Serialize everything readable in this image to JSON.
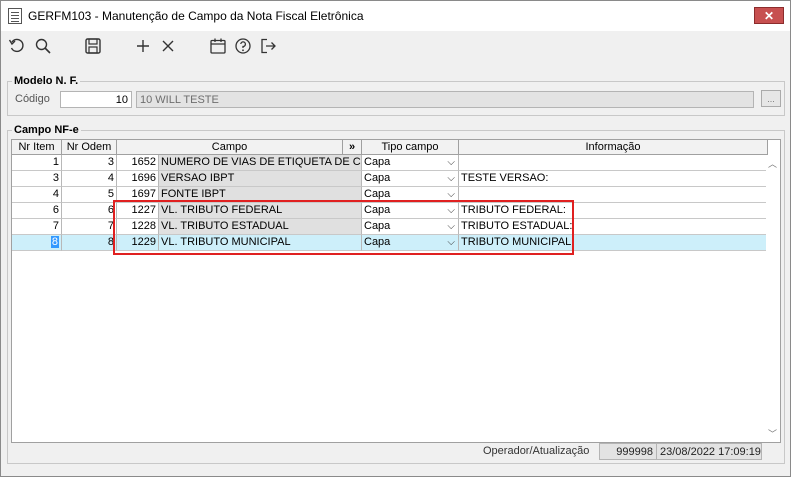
{
  "window": {
    "title": "GERFM103 - Manutenção de Campo da Nota Fiscal Eletrônica",
    "close": "✕"
  },
  "toolbar": {
    "icons": [
      "undo-icon",
      "search-icon",
      "save-icon",
      "add-icon",
      "delete-icon",
      "calendar-icon",
      "help-icon",
      "exit-icon"
    ]
  },
  "modelo": {
    "group_label": "Modelo N. F.",
    "codigo_label": "Código",
    "codigo_value": "10",
    "descricao_value": "10 WILL TESTE",
    "lookup_btn": "..."
  },
  "campo": {
    "group_label": "Campo NF-e",
    "columns": [
      "Nr Item",
      "Nr Odem",
      "Campo",
      "»",
      "Tipo campo",
      "Informação"
    ],
    "rows": [
      {
        "item": "1",
        "ordem": "3",
        "cod": "1652",
        "campo": "NUMERO DE VIAS DE ETIQUETA DE CONT",
        "tipo": "Capa",
        "info": ""
      },
      {
        "item": "3",
        "ordem": "4",
        "cod": "1696",
        "campo": "VERSAO IBPT",
        "tipo": "Capa",
        "info": "TESTE VERSAO:"
      },
      {
        "item": "4",
        "ordem": "5",
        "cod": "1697",
        "campo": "FONTE IBPT",
        "tipo": "Capa",
        "info": ""
      },
      {
        "item": "6",
        "ordem": "6",
        "cod": "1227",
        "campo": "VL. TRIBUTO FEDERAL",
        "tipo": "Capa",
        "info": "TRIBUTO FEDERAL:"
      },
      {
        "item": "7",
        "ordem": "7",
        "cod": "1228",
        "campo": "VL. TRIBUTO ESTADUAL",
        "tipo": "Capa",
        "info": "TRIBUTO ESTADUAL:"
      },
      {
        "item": "8",
        "ordem": "8",
        "cod": "1229",
        "campo": "VL. TRIBUTO MUNICIPAL",
        "tipo": "Capa",
        "info": "TRIBUTO MUNICIPAL:"
      }
    ],
    "chevron": "⌵"
  },
  "status": {
    "label": "Operador/Atualização",
    "operador": "999998",
    "data": "23/08/2022 17:09:19"
  },
  "colors": {
    "selected_row": "#cdeffa",
    "highlight_box": "#e02020",
    "close_button": "#c75050"
  }
}
